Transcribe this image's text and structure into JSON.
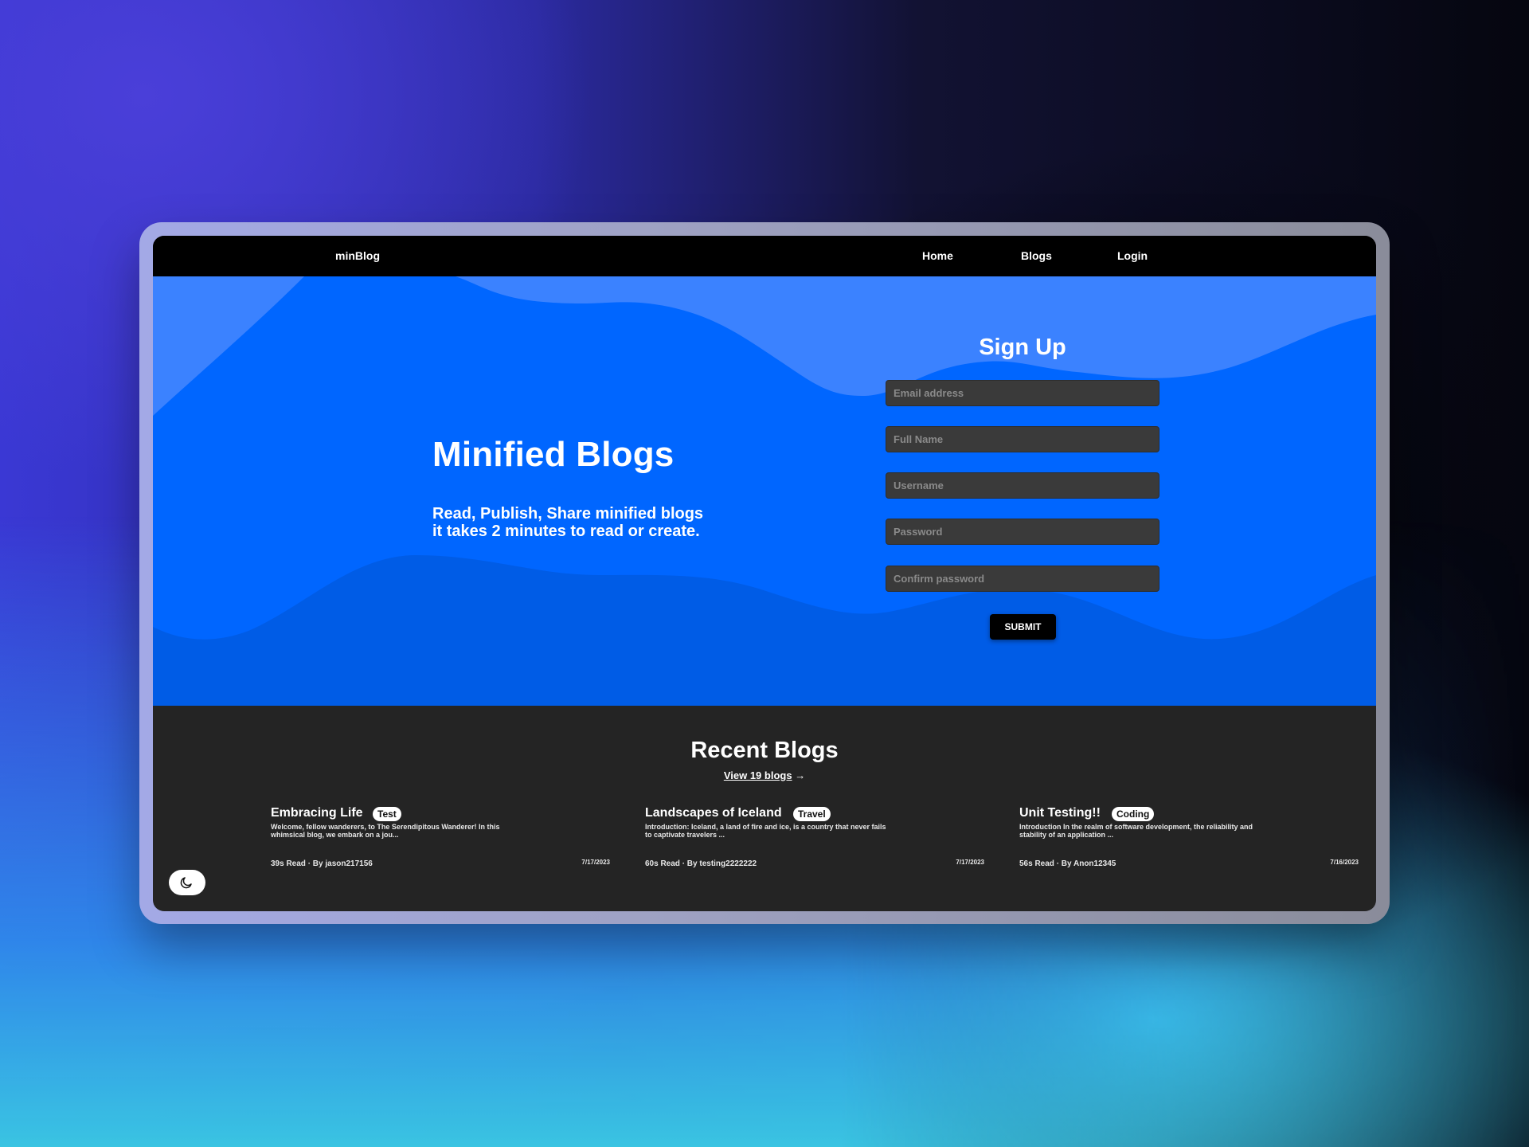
{
  "nav": {
    "brand": "minBlog",
    "links": [
      "Home",
      "Blogs",
      "Login"
    ]
  },
  "hero": {
    "title": "Minified Blogs",
    "subtitle_line1": "Read, Publish, Share minified blogs",
    "subtitle_line2": "it takes 2 minutes to read or create."
  },
  "signup": {
    "title": "Sign Up",
    "fields": [
      {
        "placeholder": "Email address",
        "value": ""
      },
      {
        "placeholder": "Full Name",
        "value": ""
      },
      {
        "placeholder": "Username",
        "value": ""
      },
      {
        "placeholder": "Password",
        "value": ""
      },
      {
        "placeholder": "Confirm password",
        "value": ""
      }
    ],
    "submit_label": "SUBMIT"
  },
  "recent": {
    "title": "Recent Blogs",
    "view_all": "View 19 blogs",
    "view_all_arrow": "→",
    "cards": [
      {
        "title": "Embracing Life",
        "tag": "Test",
        "description": "Welcome, fellow wanderers, to The Serendipitous Wanderer! In this whimsical blog, we embark on a jou...",
        "meta": "39s Read · By jason217156",
        "date": "7/17/2023"
      },
      {
        "title": "Landscapes of Iceland",
        "tag": "Travel",
        "description": "Introduction: Iceland, a land of fire and ice, is a country that never fails to captivate travelers ...",
        "meta": "60s Read · By testing2222222",
        "date": "7/17/2023"
      },
      {
        "title": "Unit Testing!!",
        "tag": "Coding",
        "description": "Introduction In the realm of software development, the reliability and stability of an application ...",
        "meta": "56s Read · By Anon12345",
        "date": "7/16/2023"
      }
    ]
  },
  "theme_toggle": {
    "icon": "moon-icon"
  },
  "colors": {
    "hero_blue": "#0066ff",
    "wave_light": "#3b82ff",
    "wave_dark": "#005ce6",
    "nav_bg": "#000000",
    "page_bg": "#242424",
    "field_bg": "#3a3a3a"
  }
}
